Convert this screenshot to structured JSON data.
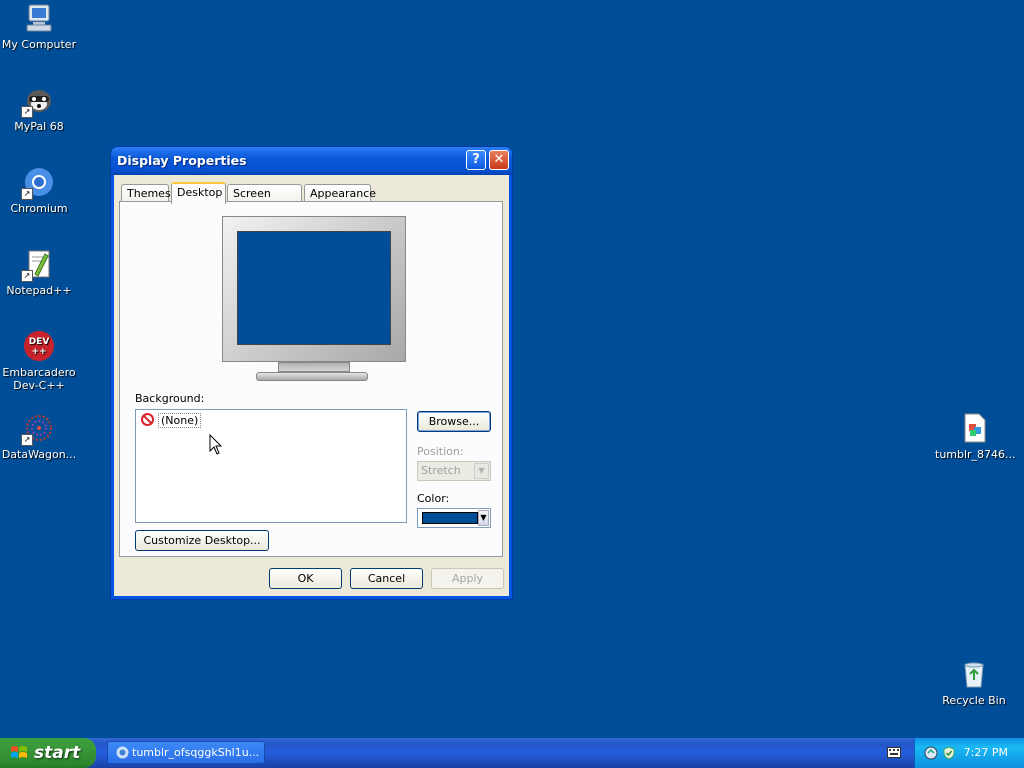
{
  "desktop": {
    "background_color": "#004e98",
    "icons": [
      {
        "label": "My Computer",
        "icon": "my-computer-icon"
      },
      {
        "label": "MyPal 68",
        "icon": "mypal-icon"
      },
      {
        "label": "Chromium",
        "icon": "chromium-icon"
      },
      {
        "label": "Notepad++",
        "icon": "notepadpp-icon"
      },
      {
        "label": "Embarcadero Dev-C++",
        "icon": "devcpp-icon"
      },
      {
        "label": "DataWagon...",
        "icon": "datawagon-icon"
      },
      {
        "label": "tumblr_8746...",
        "icon": "image-file-icon"
      },
      {
        "label": "Recycle Bin",
        "icon": "recycle-bin-icon"
      }
    ]
  },
  "dialog": {
    "title": "Display Properties",
    "tabs": [
      {
        "label": "Themes",
        "active": false
      },
      {
        "label": "Desktop",
        "active": true
      },
      {
        "label": "Screen Saver",
        "active": false
      },
      {
        "label": "Appearance",
        "active": false
      }
    ],
    "background_label": "Background:",
    "background_items": [
      "(None)"
    ],
    "browse_label": "Browse...",
    "position_label": "Position:",
    "position_value": "Stretch",
    "color_label": "Color:",
    "color_value": "#004e98",
    "customize_label": "Customize Desktop...",
    "ok_label": "OK",
    "cancel_label": "Cancel",
    "apply_label": "Apply"
  },
  "taskbar": {
    "start_label": "start",
    "task_button_label": "tumblr_ofsqggkShl1u...",
    "clock": "7:27 PM"
  }
}
